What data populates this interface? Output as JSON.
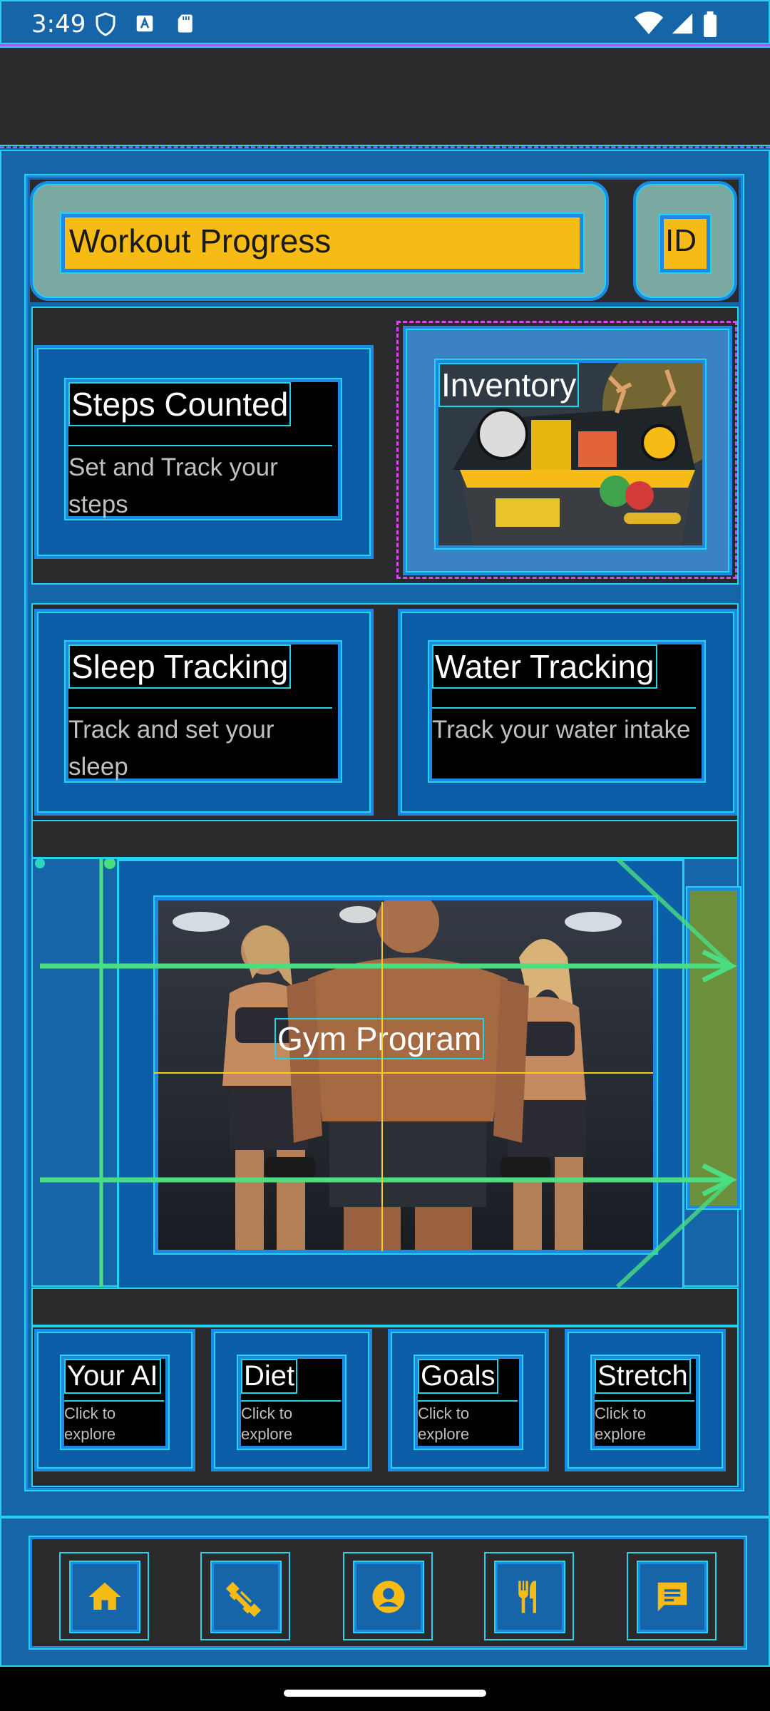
{
  "status_bar": {
    "time": "3:49"
  },
  "header": {
    "title": "Workout Progress",
    "id_label": "ID"
  },
  "cards": {
    "steps": {
      "title": "Steps Counted",
      "subtitle": "Set and Track your steps"
    },
    "inventory": {
      "title": "Inventory"
    },
    "sleep": {
      "title": "Sleep Tracking",
      "subtitle": "Track and set your sleep"
    },
    "water": {
      "title": "Water Tracking",
      "subtitle": "Track your water intake"
    }
  },
  "carousel": {
    "current_label": "Gym Program"
  },
  "quick_links": [
    {
      "title": "Your AI",
      "subtitle": "Click to explore"
    },
    {
      "title": "Diet",
      "subtitle": "Click to explore"
    },
    {
      "title": "Goals",
      "subtitle": "Click to explore"
    },
    {
      "title": "Stretch",
      "subtitle": "Click to explore"
    }
  ],
  "bottom_nav": [
    {
      "icon": "home-icon"
    },
    {
      "icon": "dumbbell-icon"
    },
    {
      "icon": "account-icon"
    },
    {
      "icon": "restaurant-icon"
    },
    {
      "icon": "chat-icon"
    }
  ],
  "colors": {
    "accent": "#f6bb14",
    "background": "#1565a8",
    "panel": "#2a2a2c",
    "debug_outline": "#22d3ee"
  }
}
